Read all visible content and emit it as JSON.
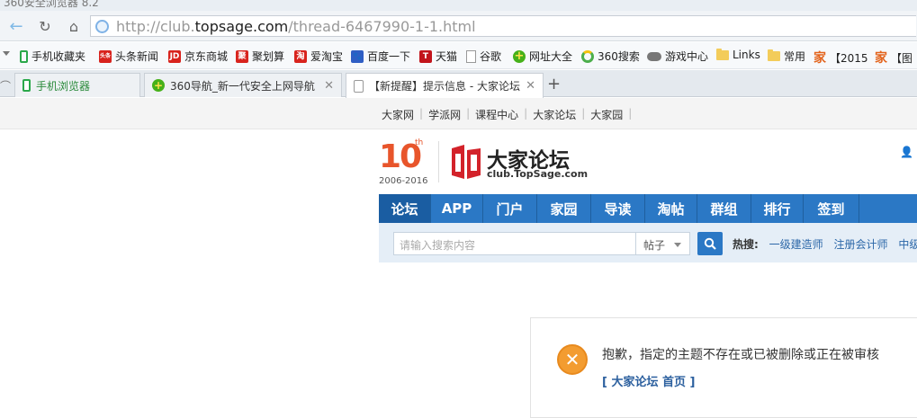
{
  "window": {
    "title_cut": "360安全浏览器 8.2"
  },
  "address": {
    "url_prefix": "http://club.",
    "url_domain": "topsage.com",
    "url_suffix": "/thread-6467990-1-1.html"
  },
  "bookmarks": [
    {
      "label": "手机收藏夹",
      "icon": "phone-icon",
      "color": "#2aa84a"
    },
    {
      "label": "头条新闻",
      "icon": "toutiao-icon",
      "color": "#d8231d",
      "glyph": "头条"
    },
    {
      "label": "京东商城",
      "icon": "jd-icon",
      "color": "#d8231d",
      "glyph": "JD"
    },
    {
      "label": "聚划算",
      "icon": "juhuasuan-icon",
      "color": "#d8231d",
      "glyph": "聚"
    },
    {
      "label": "爱淘宝",
      "icon": "taobao-icon",
      "color": "#d8231d",
      "glyph": "淘"
    },
    {
      "label": "百度一下",
      "icon": "baidu-icon",
      "color": "#2f5ec4",
      "glyph": "🐾"
    },
    {
      "label": "天猫",
      "icon": "tmall-icon",
      "color": "#c2141b",
      "glyph": "T"
    },
    {
      "label": "谷歌",
      "icon": "page-icon",
      "color": "#ffffff"
    },
    {
      "label": "网址大全",
      "icon": "360nav-icon",
      "color": "#46b11a",
      "glyph": "+"
    },
    {
      "label": "360搜索",
      "icon": "360search-icon",
      "color": "#4cae4c"
    },
    {
      "label": "游戏中心",
      "icon": "gamepad-icon",
      "color": "#666666"
    },
    {
      "label": "Links",
      "icon": "folder-icon"
    },
    {
      "label": "常用",
      "icon": "folder-icon"
    },
    {
      "label": "【2015",
      "icon": "jia-icon",
      "glyph": "家"
    },
    {
      "label": "【图",
      "icon": "jia-icon",
      "glyph": "家"
    }
  ],
  "tabs": [
    {
      "label": "手机浏览器",
      "icon": "phone-icon"
    },
    {
      "label": "360导航_新一代安全上网导航",
      "icon": "360nav-icon"
    },
    {
      "label": "【新提醒】提示信息 - 大家论坛",
      "icon": "page-icon"
    }
  ],
  "site": {
    "toplinks": [
      "大家网",
      "学派网",
      "课程中心",
      "大家论坛",
      "大家园"
    ],
    "anniv_num": "10",
    "anniv_th": "th",
    "anniv_years": "2006-2016",
    "logo_name": "大家论坛",
    "logo_domain": "club.TopSage.com",
    "nav": [
      "论坛",
      "APP",
      "门户",
      "家园",
      "导读",
      "淘帖",
      "群组",
      "排行",
      "签到"
    ],
    "search_placeholder": "请输入搜索内容",
    "search_type": "帖子",
    "hot_label": "热搜:",
    "hot_links": [
      "一级建造师",
      "注册会计师",
      "中级经"
    ]
  },
  "message": {
    "text": "抱歉，指定的主题不存在或已被删除或正在被审核",
    "link": "[ 大家论坛 首页 ]"
  },
  "colors": {
    "nav_blue": "#2b78c5",
    "accent_orange": "#f39c30"
  }
}
